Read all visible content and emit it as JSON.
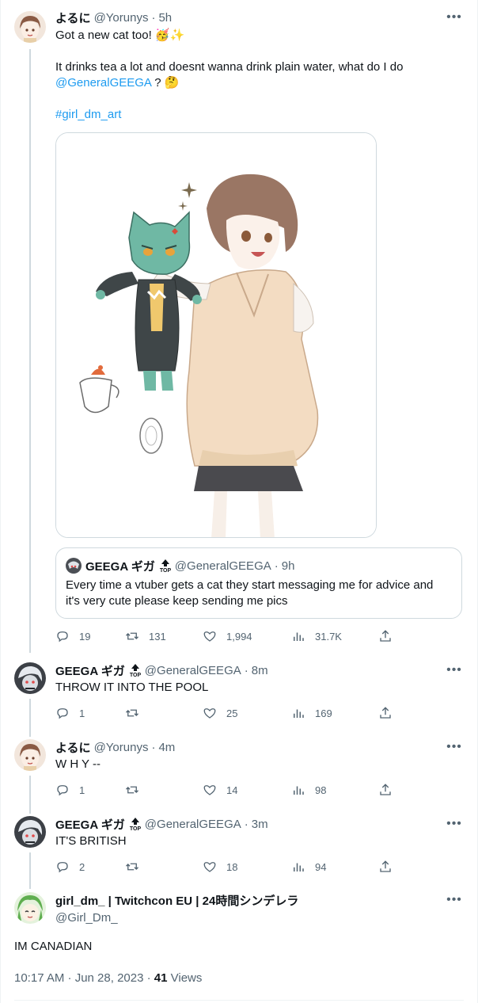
{
  "colors": {
    "accent": "#1d9bf0",
    "secondary_text": "#536471",
    "line": "#cfd9de"
  },
  "main_tweet": {
    "name": "よるに",
    "handle": "@Yorunys",
    "time": "5h",
    "line1": "Got a new cat too! 🥳✨",
    "line2": "It drinks tea a lot and doesnt wanna drink plain water, what do I do",
    "mention": "@GeneralGEEGA",
    "after_mention": " ? 🤔",
    "hashtag": "#girl_dm_art",
    "quote": {
      "name": "GEEGA ギガ",
      "handle": "@GeneralGEEGA",
      "time": "9h",
      "text": "Every time a vtuber gets a cat they start messaging me for advice and it's very cute please keep sending me pics"
    },
    "stats": {
      "replies": "19",
      "retweets": "131",
      "likes": "1,994",
      "views": "31.7K"
    }
  },
  "replies": [
    {
      "name": "GEEGA ギガ",
      "handle": "@GeneralGEEGA",
      "time": "8m",
      "text": "THROW IT INTO THE POOL",
      "replies": "1",
      "likes": "25",
      "views": "169"
    },
    {
      "name": "よるに",
      "handle": "@Yorunys",
      "time": "4m",
      "text": "W H Y --",
      "replies": "1",
      "likes": "14",
      "views": "98"
    },
    {
      "name": "GEEGA ギガ",
      "handle": "@GeneralGEEGA",
      "time": "3m",
      "text": "IT'S BRITISH",
      "replies": "2",
      "likes": "18",
      "views": "94"
    }
  ],
  "final_tweet": {
    "name": "girl_dm_ | Twitchcon EU | 24時間シンデレラ",
    "handle": "@Girl_Dm_",
    "text": "IM CANADIAN",
    "timestamp": "10:17 AM · Jun 28, 2023 · ",
    "views_count": "41",
    "views_label": " Views"
  },
  "icons": [
    "more-icon",
    "reply-icon",
    "retweet-icon",
    "like-icon",
    "views-icon",
    "share-icon",
    "top-badge-icon"
  ]
}
